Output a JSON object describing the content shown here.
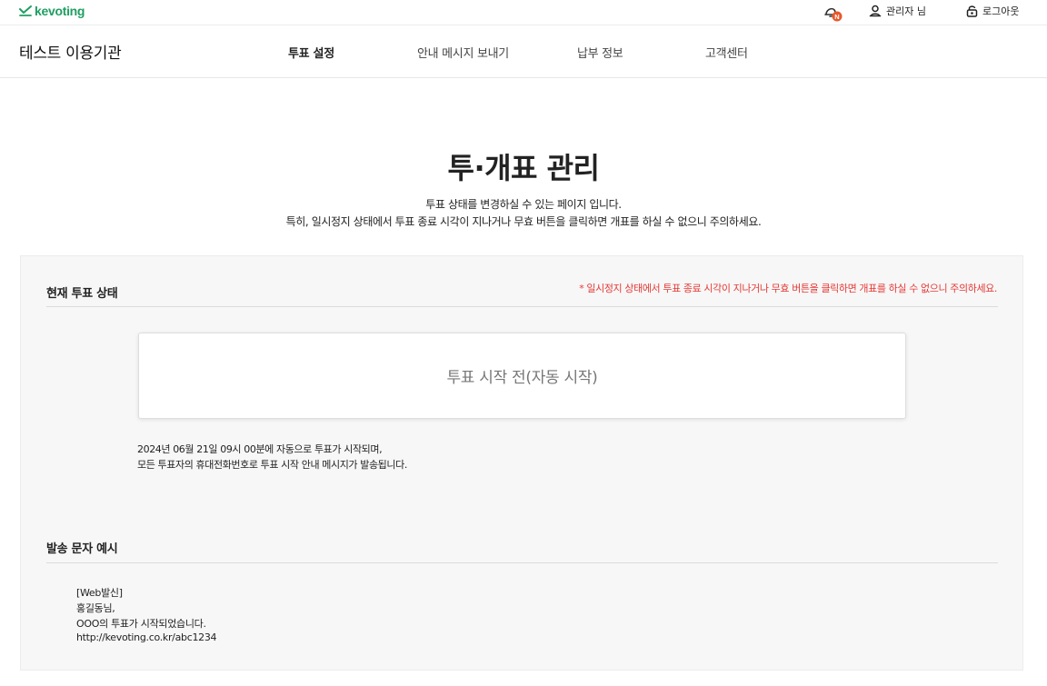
{
  "brand": {
    "logo_text": "kevoting",
    "accent": "#1f9e62"
  },
  "util": {
    "admin_label": "관리자 님",
    "logout_label": "로그아웃",
    "notification_badge": "N",
    "badge_color": "#e8582a"
  },
  "nav": {
    "org_name": "테스트 이용기관",
    "items": [
      {
        "label": "투표 설정",
        "active": true
      },
      {
        "label": "안내 메시지 보내기",
        "active": false
      },
      {
        "label": "납부 정보",
        "active": false
      },
      {
        "label": "고객센터",
        "active": false
      }
    ]
  },
  "page": {
    "title": "투·개표 관리",
    "desc1": "투표 상태를 변경하실 수 있는 페이지 입니다.",
    "desc2": "특히, 일시정지 상태에서 투표 종료 시각이 지나거나 무효 버튼을 클릭하면 개표를 하실 수 없으니 주의하세요."
  },
  "status_section": {
    "heading": "현재 투표 상태",
    "warning": "* 일시정지 상태에서 투표 종료 시각이 지나거나 무효 버튼을 클릭하면 개표를 하실 수 없으니 주의하세요.",
    "warning_color": "#e53935",
    "status": "투표 시작 전(자동 시작)",
    "info_line1": "2024년 06월 21일 09시 00분에 자동으로 투표가 시작되며,",
    "info_line2": "모든 투표자의 휴대전화번호로 투표 시작 안내 메시지가 발송됩니다."
  },
  "sample_section": {
    "heading": "발송 문자 예시",
    "lines": [
      "[Web발신]",
      "홍길동님,",
      "OOO의 투표가 시작되었습니다.",
      "http://kevoting.co.kr/abc1234"
    ]
  }
}
